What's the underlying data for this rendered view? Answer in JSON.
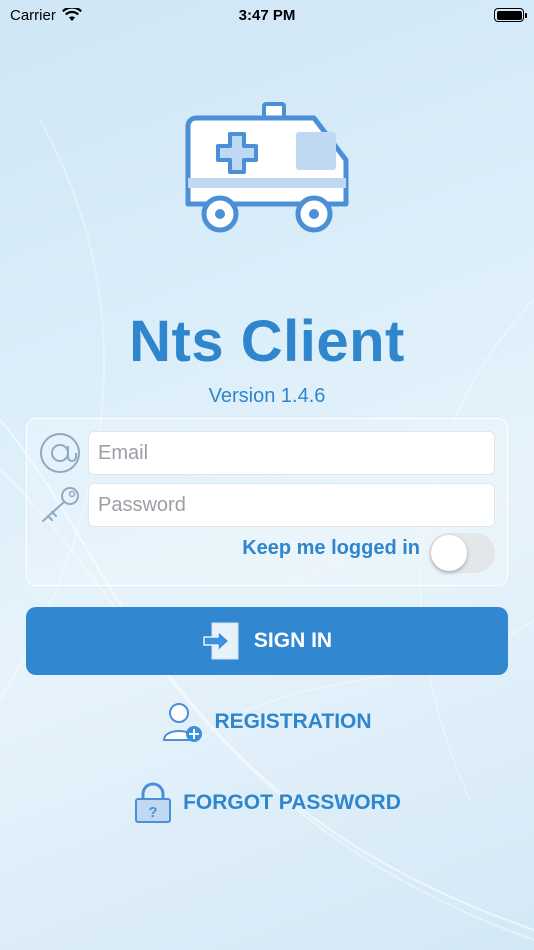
{
  "status_bar": {
    "carrier": "Carrier",
    "time": "3:47 PM",
    "battery_percent": 100
  },
  "app": {
    "title": "Nts Client",
    "version": "Version 1.4.6"
  },
  "login": {
    "email_placeholder": "Email",
    "email_value": "",
    "password_placeholder": "Password",
    "password_value": "",
    "keep_logged_in_label": "Keep me logged in",
    "keep_logged_in": false
  },
  "actions": {
    "signin_label": "SIGN IN",
    "registration_label": "REGISTRATION",
    "forgot_label": "FORGOT PASSWORD"
  },
  "colors": {
    "accent": "#3188d0",
    "text": "#2f86cc",
    "ambulance": "#4b8fd6"
  },
  "icons": {
    "logo": "ambulance-icon",
    "email": "at-sign-icon",
    "password": "key-icon",
    "signin": "sign-in-icon",
    "registration": "add-user-icon",
    "forgot": "padlock-question-icon"
  }
}
